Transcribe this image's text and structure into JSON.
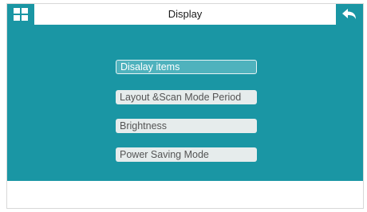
{
  "header": {
    "title": "Display",
    "home_icon": "grid-icon",
    "back_icon": "back-arrow-icon"
  },
  "menu": {
    "items": [
      {
        "label": "Disalay items",
        "selected": true
      },
      {
        "label": "Layout &Scan Mode Period",
        "selected": false
      },
      {
        "label": "Brightness",
        "selected": false
      },
      {
        "label": "Power Saving Mode",
        "selected": false
      }
    ]
  },
  "colors": {
    "accent": "#1a96a4",
    "selected_item": "#4fb2bd",
    "item_background": "#e6ecec"
  }
}
